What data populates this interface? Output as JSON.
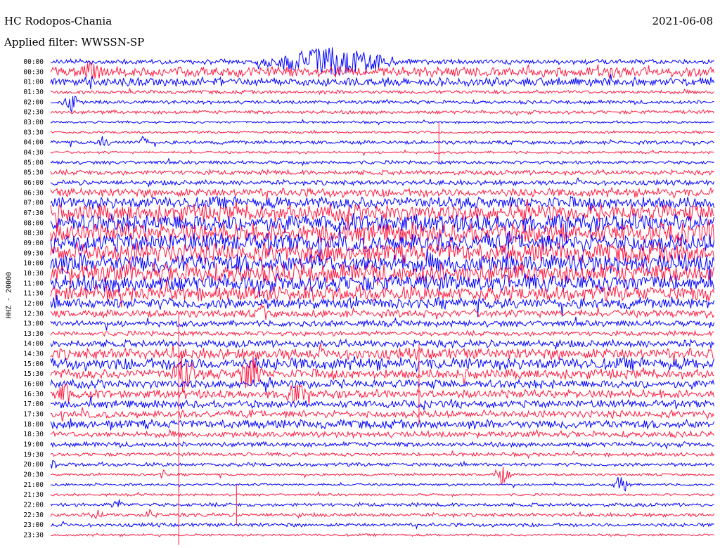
{
  "header": {
    "station": "HC Rodopos-Chania",
    "filter": "Applied filter: WWSSN-SP",
    "date": "2021-06-08"
  },
  "chart_data": {
    "type": "line",
    "title": "HC Rodopos-Chania",
    "channel_label": "HHZ - 20000",
    "row_interval_minutes": 30,
    "colors": [
      "#0000ff",
      "#ff1a40"
    ],
    "time_labels": [
      "00:00",
      "00:30",
      "01:00",
      "01:30",
      "02:00",
      "02:30",
      "03:00",
      "03:30",
      "04:00",
      "04:30",
      "05:00",
      "05:30",
      "06:00",
      "06:30",
      "07:00",
      "07:30",
      "08:00",
      "08:30",
      "09:00",
      "09:30",
      "10:00",
      "10:30",
      "11:00",
      "11:30",
      "12:00",
      "12:30",
      "13:00",
      "13:30",
      "14:00",
      "14:30",
      "15:00",
      "15:30",
      "16:00",
      "16:30",
      "17:00",
      "17:30",
      "18:00",
      "18:30",
      "19:00",
      "19:30",
      "20:00",
      "20:30",
      "21:00",
      "21:30",
      "22:00",
      "22:30",
      "23:00",
      "23:30"
    ],
    "noise_level": [
      4,
      8,
      7,
      3,
      3,
      3,
      2,
      2,
      3,
      2,
      3,
      4,
      4,
      7,
      10,
      14,
      15,
      16,
      15,
      16,
      16,
      16,
      14,
      12,
      9,
      6,
      5,
      4,
      6,
      9,
      10,
      8,
      7,
      7,
      6,
      6,
      7,
      5,
      4,
      3,
      3,
      2,
      2,
      2,
      3,
      3,
      3,
      2
    ],
    "events": [
      {
        "row": 0,
        "pos": 0.42,
        "amp": 20,
        "width": 0.12
      },
      {
        "row": 1,
        "pos": 0.06,
        "amp": 12,
        "width": 0.02
      },
      {
        "row": 4,
        "pos": 0.03,
        "amp": 14,
        "width": 0.015
      },
      {
        "row": 8,
        "pos": 0.08,
        "amp": 10,
        "width": 0.01
      },
      {
        "row": 8,
        "pos": 0.14,
        "amp": 12,
        "width": 0.008
      },
      {
        "row": 25,
        "pos": 0.32,
        "amp": 14,
        "width": 0.01
      },
      {
        "row": 31,
        "pos": 0.2,
        "amp": 30,
        "width": 0.02
      },
      {
        "row": 31,
        "pos": 0.3,
        "amp": 26,
        "width": 0.02
      },
      {
        "row": 33,
        "pos": 0.02,
        "amp": 14,
        "width": 0.02
      },
      {
        "row": 33,
        "pos": 0.37,
        "amp": 12,
        "width": 0.02
      },
      {
        "row": 40,
        "pos": 0.0,
        "amp": 6,
        "width": 0.01
      },
      {
        "row": 41,
        "pos": 0.17,
        "amp": 6,
        "width": 0.008
      },
      {
        "row": 41,
        "pos": 0.68,
        "amp": 14,
        "width": 0.015
      },
      {
        "row": 42,
        "pos": 0.86,
        "amp": 16,
        "width": 0.015
      },
      {
        "row": 44,
        "pos": 0.1,
        "amp": 8,
        "width": 0.01
      },
      {
        "row": 45,
        "pos": 0.07,
        "amp": 9,
        "width": 0.01
      },
      {
        "row": 45,
        "pos": 0.15,
        "amp": 8,
        "width": 0.01
      }
    ],
    "spikes": [
      {
        "pos": 0.193,
        "from_row": 25,
        "to_row": 48
      },
      {
        "pos": 0.585,
        "from_row": 6,
        "to_row": 10
      },
      {
        "pos": 0.555,
        "from_row": 28,
        "to_row": 36
      },
      {
        "pos": 0.28,
        "from_row": 42,
        "to_row": 46
      }
    ]
  }
}
